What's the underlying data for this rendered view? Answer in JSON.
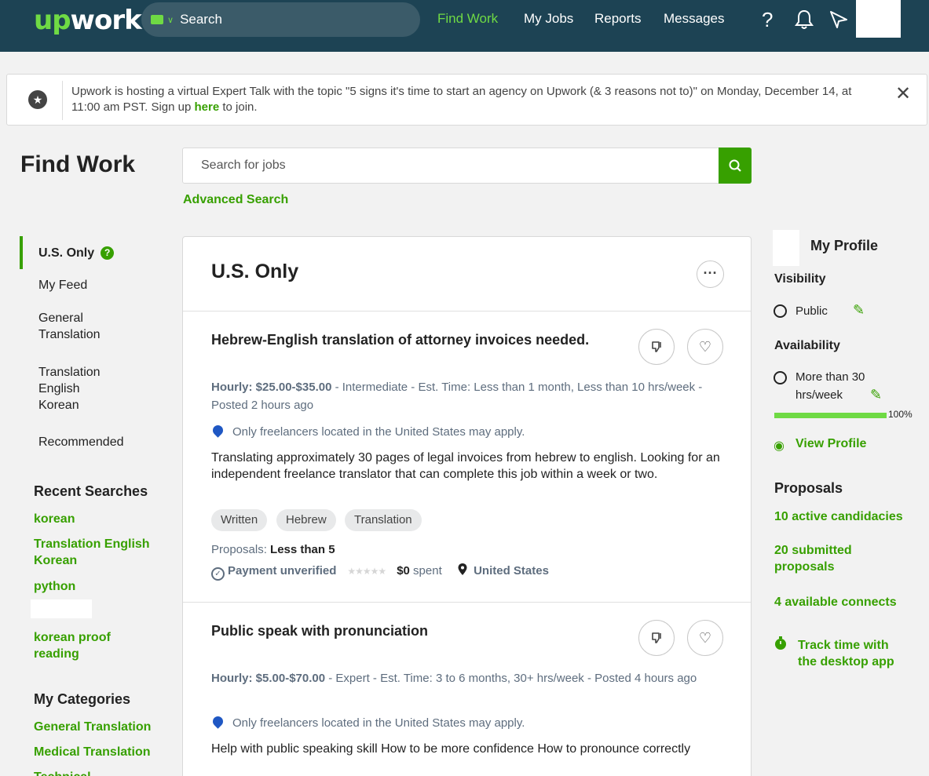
{
  "header": {
    "logo": "upwork",
    "search_label": "Search",
    "nav": [
      "Find Work",
      "My Jobs",
      "Reports",
      "Messages"
    ],
    "icons": [
      "help-icon",
      "bell-icon",
      "send-icon"
    ]
  },
  "banner": {
    "text_before": "Upwork is hosting a virtual Expert Talk with the topic \"5 signs it's time to start an agency on Upwork (& 3 reasons not to)\" on Monday, December 14, at 11:00 am PST. Sign up ",
    "link": "here",
    "text_after": " to join."
  },
  "page": {
    "title": "Find Work",
    "search_placeholder": "Search for jobs",
    "advanced_search": "Advanced Search"
  },
  "sidebar": {
    "feeds": [
      {
        "label": "U.S. Only"
      },
      {
        "label": "My Feed"
      },
      {
        "label": "General Translation"
      },
      {
        "label": "Translation English Korean"
      },
      {
        "label": "Recommended"
      }
    ],
    "recent_heading": "Recent Searches",
    "recent": [
      "korean",
      "Translation English Korean",
      "python",
      "korean proof reading"
    ],
    "categories_heading": "My Categories",
    "categories": [
      "General Translation",
      "Medical Translation",
      "Technical"
    ]
  },
  "feed": {
    "title": "U.S. Only",
    "jobs": [
      {
        "title": "Hebrew-English translation of attorney invoices needed.",
        "rate": "Hourly: $25.00-$35.00",
        "details": " - Intermediate - Est. Time: Less than 1 month, Less than 10 hrs/week - Posted 2 hours ago",
        "location_note": "Only freelancers located in the United States may apply.",
        "description": "Translating approximately 30 pages of legal invoices from hebrew to english. Looking for an independent freelance translator that can complete this job within a week or two.",
        "tags": [
          "Written",
          "Hebrew",
          "Translation"
        ],
        "proposals_label": "Proposals: ",
        "proposals_value": "Less than 5",
        "payment": "Payment unverified",
        "spent_amount": "$0",
        "spent_label": " spent",
        "country": "United States"
      },
      {
        "title": "Public speak with pronunciation",
        "rate": "Hourly: $5.00-$70.00",
        "details": " - Expert - Est. Time: 3 to 6 months, 30+ hrs/week - Posted 4 hours ago",
        "location_note": "Only freelancers located in the United States may apply.",
        "description": "Help with public speaking skill How to be more confidence How to pronounce correctly"
      }
    ]
  },
  "profile": {
    "title": "My Profile",
    "visibility_label": "Visibility",
    "visibility_value": "Public",
    "availability_label": "Availability",
    "availability_value": "More than 30 hrs/week",
    "completeness": "100%",
    "completeness_fraction": 1.0,
    "view_profile": "View Profile",
    "proposals_heading": "Proposals",
    "proposal_links": [
      "10 active candidacies",
      "20 submitted proposals",
      "4 available connects"
    ],
    "track_time": "Track time with the desktop app"
  },
  "colors": {
    "header_bg": "#1d4354",
    "accent": "#37a000",
    "accent_light": "#6fda44"
  }
}
